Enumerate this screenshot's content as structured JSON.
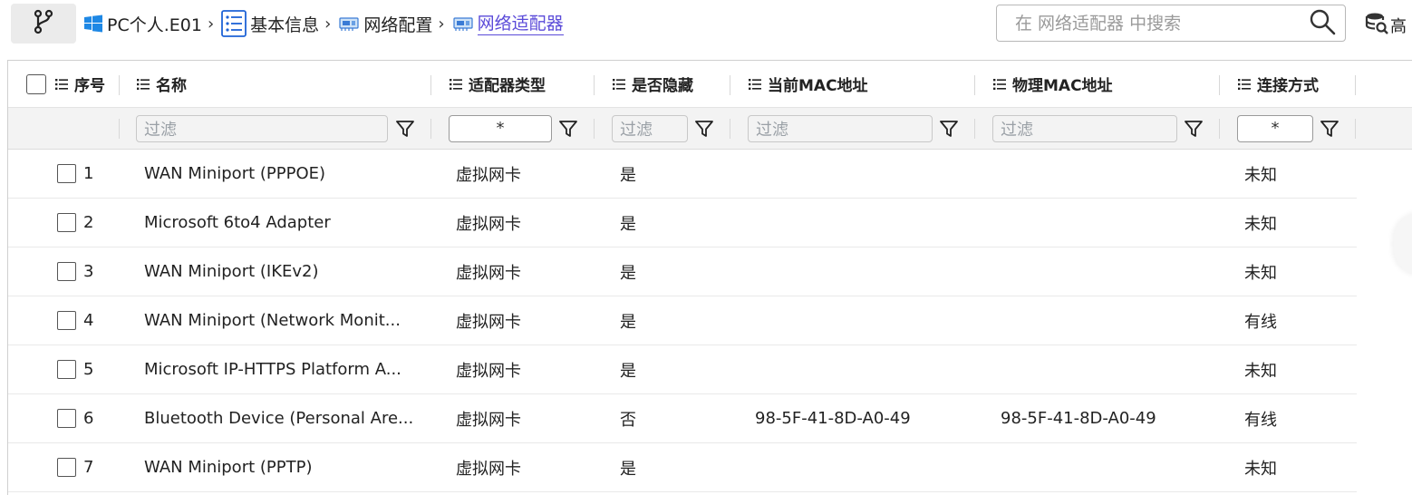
{
  "breadcrumb": {
    "items": [
      {
        "label": "PC个人.E01",
        "icon": "windows-icon"
      },
      {
        "label": "基本信息",
        "icon": "list-icon"
      },
      {
        "label": "网络配置",
        "icon": "network-card-icon"
      },
      {
        "label": "网络适配器",
        "icon": "network-card-icon"
      }
    ],
    "separator": "›"
  },
  "search": {
    "placeholder": "在 网络适配器 中搜索"
  },
  "advanced": {
    "label": "高"
  },
  "table": {
    "headers": {
      "index": "序号",
      "name": "名称",
      "adapter_type": "适配器类型",
      "hidden": "是否隐藏",
      "current_mac": "当前MAC地址",
      "physical_mac": "物理MAC地址",
      "connection": "连接方式"
    },
    "filters": {
      "name": "过滤",
      "adapter_type": "*",
      "hidden": "过滤",
      "current_mac": "过滤",
      "physical_mac": "过滤",
      "connection": "*"
    },
    "rows": [
      {
        "index": "1",
        "name": "WAN Miniport (PPPOE)",
        "adapter_type": "虚拟网卡",
        "hidden": "是",
        "current_mac": "",
        "physical_mac": "",
        "connection": "未知"
      },
      {
        "index": "2",
        "name": "Microsoft 6to4 Adapter",
        "adapter_type": "虚拟网卡",
        "hidden": "是",
        "current_mac": "",
        "physical_mac": "",
        "connection": "未知"
      },
      {
        "index": "3",
        "name": "WAN Miniport (IKEv2)",
        "adapter_type": "虚拟网卡",
        "hidden": "是",
        "current_mac": "",
        "physical_mac": "",
        "connection": "未知"
      },
      {
        "index": "4",
        "name": "WAN Miniport (Network Monit...",
        "adapter_type": "虚拟网卡",
        "hidden": "是",
        "current_mac": "",
        "physical_mac": "",
        "connection": "有线"
      },
      {
        "index": "5",
        "name": "Microsoft IP-HTTPS Platform A...",
        "adapter_type": "虚拟网卡",
        "hidden": "是",
        "current_mac": "",
        "physical_mac": "",
        "connection": "未知"
      },
      {
        "index": "6",
        "name": "Bluetooth Device (Personal Are...",
        "adapter_type": "虚拟网卡",
        "hidden": "否",
        "current_mac": "98-5F-41-8D-A0-49",
        "physical_mac": "98-5F-41-8D-A0-49",
        "connection": "有线"
      },
      {
        "index": "7",
        "name": "WAN Miniport (PPTP)",
        "adapter_type": "虚拟网卡",
        "hidden": "是",
        "current_mac": "",
        "physical_mac": "",
        "connection": "未知"
      }
    ]
  },
  "colors": {
    "accent": "#5b4bd9",
    "windows_blue": "#1e88e5"
  }
}
